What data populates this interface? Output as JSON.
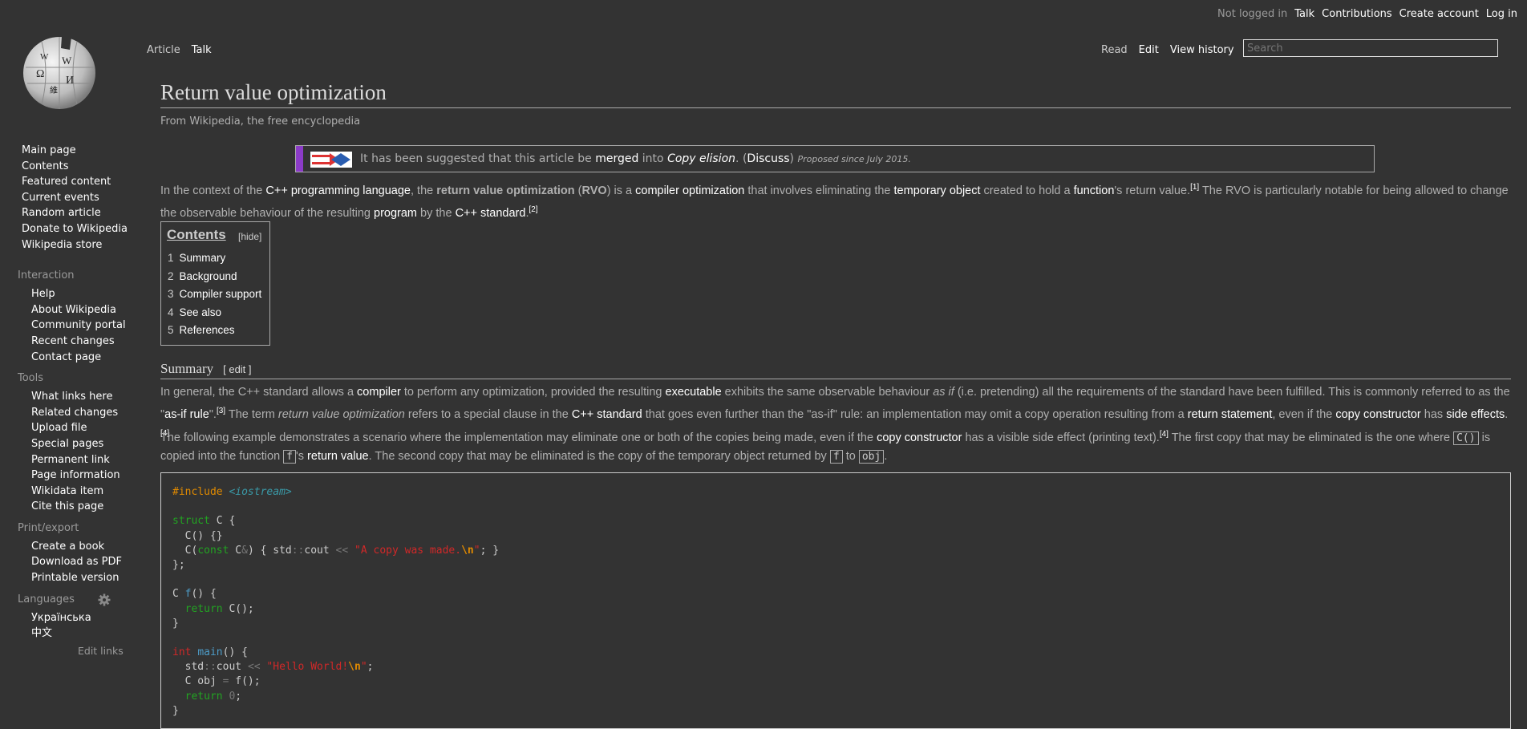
{
  "personal": {
    "not_logged": "Not logged in",
    "talk": "Talk",
    "contributions": "Contributions",
    "create_account": "Create account",
    "login": "Log in"
  },
  "tabs": {
    "article": "Article",
    "talk": "Talk",
    "read": "Read",
    "edit": "Edit",
    "history": "View history"
  },
  "search": {
    "placeholder": "Search"
  },
  "sidebar": {
    "main": [
      "Main page",
      "Contents",
      "Featured content",
      "Current events",
      "Random article",
      "Donate to Wikipedia",
      "Wikipedia store"
    ],
    "interaction": {
      "heading": "Interaction",
      "items": [
        "Help",
        "About Wikipedia",
        "Community portal",
        "Recent changes",
        "Contact page"
      ]
    },
    "tools": {
      "heading": "Tools",
      "items": [
        "What links here",
        "Related changes",
        "Upload file",
        "Special pages",
        "Permanent link",
        "Page information",
        "Wikidata item",
        "Cite this page"
      ]
    },
    "print": {
      "heading": "Print/export",
      "items": [
        "Create a book",
        "Download as PDF",
        "Printable version"
      ]
    },
    "languages": {
      "heading": "Languages",
      "items": [
        "Українська",
        "中文"
      ],
      "edit_links": "Edit links"
    }
  },
  "article": {
    "title": "Return value optimization",
    "subtitle": "From Wikipedia, the free encyclopedia",
    "merge": {
      "pre": "It has been suggested that this article be ",
      "merged": "merged",
      "mid": " into ",
      "target": "Copy elision",
      "post": ". (",
      "discuss": "Discuss",
      "close": ")",
      "since": "Proposed since July 2015."
    },
    "intro": {
      "t1": "In the context of the ",
      "l1": "C++",
      "t2": " ",
      "l2": "programming language",
      "t3": ", the ",
      "b1": "return value optimization",
      "t4": " (",
      "b2": "RVO",
      "t5": ") is a ",
      "l3": "compiler optimization",
      "t6": " that involves eliminating the ",
      "l4": "temporary object",
      "t7": " created to hold a ",
      "l5": "function",
      "t8": "'s return value.",
      "s1": "[1]",
      "t9": " The RVO is particularly notable for being allowed to change the observable behaviour of the resulting ",
      "l6": "program",
      "t10": " by the ",
      "l7": "C++ standard",
      "t11": ".",
      "s2": "[2]"
    },
    "toc": {
      "title": "Contents",
      "hide": "[hide]",
      "items": [
        {
          "num": "1",
          "label": "Summary"
        },
        {
          "num": "2",
          "label": "Background"
        },
        {
          "num": "3",
          "label": "Compiler support"
        },
        {
          "num": "4",
          "label": "See also"
        },
        {
          "num": "5",
          "label": "References"
        }
      ]
    },
    "summary": {
      "heading": "Summary",
      "edit": "[ edit ]",
      "p1": {
        "t1": "In general, the C++ standard allows a ",
        "l1": "compiler",
        "t2": " to perform any optimization, provided the resulting ",
        "l2": "executable",
        "t3": " exhibits the same observable behaviour ",
        "i1": "as if",
        "t4": " (i.e. pretending) all the requirements of the standard have been fulfilled. This is commonly referred to as the \"",
        "l3": "as-if rule",
        "t5": "\".",
        "s1": "[3]",
        "t6": " The term ",
        "i2": "return value optimization",
        "t7": " refers to a special clause in the ",
        "l4": "C++ standard",
        "t8": " that goes even further than the \"as-if\" rule: an implementation may omit a copy operation resulting from a ",
        "l5": "return statement",
        "t9": ", even if the ",
        "l6": "copy constructor",
        "t10": " has ",
        "l7": "side effects",
        "t11": ".",
        "s2": "[4]"
      },
      "p2": {
        "t1": "The following example demonstrates a scenario where the implementation may eliminate one or both of the copies being made, even if the ",
        "l1": "copy constructor",
        "t2": " has a visible side effect (printing text).",
        "s1": "[4]",
        "t3": " The first copy that may be eliminated is the one where ",
        "c1": "C()",
        "t4": " is copied into the function ",
        "c2": "f",
        "t5": "'s ",
        "l2": "return value",
        "t6": ". The second copy that may be eliminated is the copy of the temporary object returned by ",
        "c3": "f",
        "t7": " to ",
        "c4": "obj",
        "t8": "."
      }
    },
    "code": {
      "include_kw": "#include",
      "include_file": "<iostream>",
      "struct_kw": "struct",
      "struct_name": " C {",
      "ctor1": "  C() {}",
      "ctor2_a": "  C(",
      "const_kw": "const",
      "ctor2_b": " C",
      "amp": "&",
      "ctor2_c": ") { std",
      "dc1": "::",
      "ctor2_d": "cout ",
      "shl1": "<<",
      "ctor2_e": " ",
      "str1": "\"A copy was made.",
      "esc1": "\\n",
      "str1_end": "\"",
      "ctor2_f": "; }",
      "end_struct": "};",
      "f_a": "C ",
      "f_name": "f",
      "f_b": "() {",
      "ret_kw": "  return",
      "ret_val": " C();",
      "close1": "}",
      "int_kw": "int",
      "main_sp": " ",
      "main_name": "main",
      "main_b": "() {",
      "cout_a": "  std",
      "dc2": "::",
      "cout_b": "cout ",
      "shl2": "<<",
      "cout_c": " ",
      "str2": "\"Hello World!",
      "esc2": "\\n",
      "str2_end": "\"",
      "cout_d": ";",
      "obj_a": "  C obj ",
      "eq": "=",
      "obj_b": " f();",
      "ret2_kw": "  return",
      "ret2_sp": " ",
      "zero": "0",
      "ret2_semi": ";",
      "close2": "}"
    }
  }
}
